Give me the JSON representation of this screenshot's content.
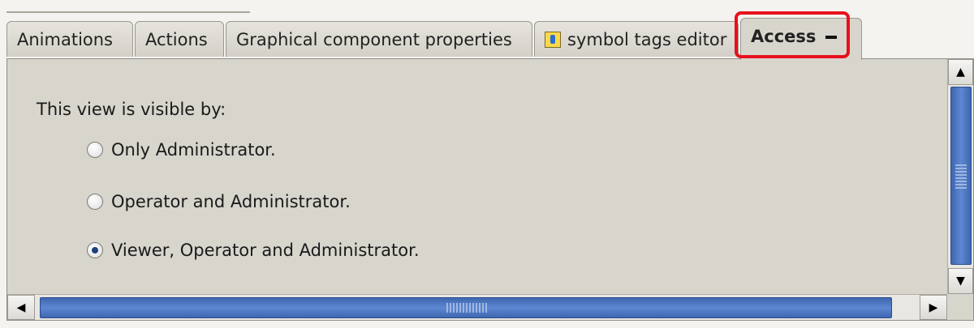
{
  "tabs": [
    {
      "label": "Animations"
    },
    {
      "label": "Actions"
    },
    {
      "label": "Graphical component properties"
    },
    {
      "label": "symbol tags editor",
      "icon": "symbol-tags-icon"
    },
    {
      "label": "Access",
      "active": true,
      "minimize_icon": "minimize-icon"
    }
  ],
  "highlight_color": "#e8101c",
  "panel": {
    "heading": "This view is visible by:",
    "options": [
      {
        "label": "Only Administrator.",
        "selected": false
      },
      {
        "label": "Operator and Administrator.",
        "selected": false
      },
      {
        "label": "Viewer, Operator and Administrator.",
        "selected": true
      }
    ]
  },
  "scrollbars": {
    "up_arrow": "▲",
    "down_arrow": "▼",
    "left_arrow": "◀",
    "right_arrow": "▶"
  },
  "colors": {
    "panel_bg": "#d8d5cd",
    "thumb": "#4a74c0"
  }
}
